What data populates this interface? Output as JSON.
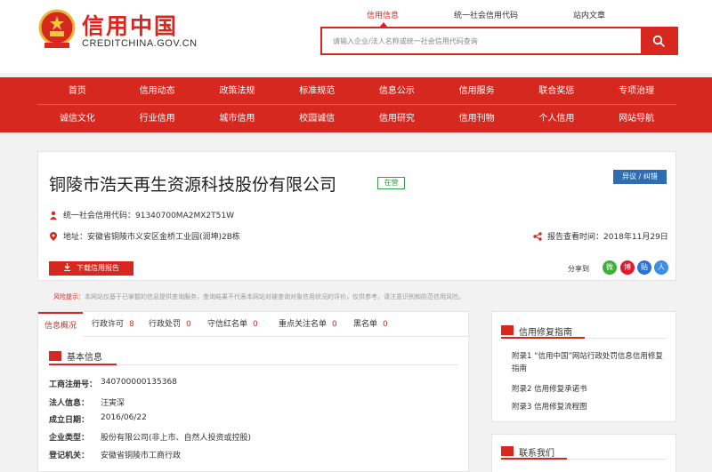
{
  "header": {
    "logo_cn": "信用中国",
    "logo_en": "CREDITCHINA.GOV.CN",
    "search_tabs": [
      "信用信息",
      "统一社会信用代码",
      "站内文章"
    ],
    "search_placeholder": "请输入企业/法人名称或统一社会信用代码查询"
  },
  "nav": {
    "row1": [
      "首页",
      "信用动态",
      "政策法规",
      "标准规范",
      "信息公示",
      "信用服务",
      "联合奖惩",
      "专项治理"
    ],
    "row2": [
      "诚信文化",
      "行业信用",
      "城市信用",
      "校园诚信",
      "信用研究",
      "信用刊物",
      "个人信用",
      "网站导航"
    ]
  },
  "company": {
    "name": "铜陵市浩天再生资源科技股份有限公司",
    "status": "在营",
    "dispute": "异议 / 纠错",
    "credit_code": "统一社会信用代码：91340700MA2MX2T51W",
    "address": "地址：安徽省铜陵市义安区金桥工业园(润坤)2B栋",
    "report_time": "报告查看时间：2018年11月29日",
    "download": "下载信用报告",
    "share_label": "分享到",
    "share_icons": [
      "微",
      "博",
      "贴",
      "人"
    ]
  },
  "risk": {
    "label": "风险提示：",
    "text": "本网站仅基于已掌握的信息提供查询服务，查询结果不代表本网站对被查询对象信用状况的评价，仅供参考，请注意识别和防范信用风险。"
  },
  "tabs": [
    {
      "label": "信息概况",
      "count": ""
    },
    {
      "label": "行政许可",
      "count": "8"
    },
    {
      "label": "行政处罚",
      "count": "0"
    },
    {
      "label": "守信红名单",
      "count": "0"
    },
    {
      "label": "重点关注名单",
      "count": "0"
    },
    {
      "label": "黑名单",
      "count": "0"
    }
  ],
  "basic": {
    "title": "基本信息",
    "fields": [
      {
        "label": "工商注册号：",
        "value": "340700000135368"
      },
      {
        "label": "法人信息：",
        "value": "汪寅深"
      },
      {
        "label": "成立日期：",
        "value": "2016/06/22"
      },
      {
        "label": "企业类型：",
        "value": "股份有限公司(非上市、自然人投资或控股)"
      },
      {
        "label": "登记机关：",
        "value": "安徽省铜陵市工商行政"
      }
    ]
  },
  "repair_guide": {
    "title": "信用修复指南",
    "links": [
      "附录1 “信用中国”网站行政处罚信息信用修复指南",
      "附录2 信用修复承诺书",
      "附录3 信用修复流程图"
    ]
  },
  "contact": {
    "title": "联系我们"
  }
}
